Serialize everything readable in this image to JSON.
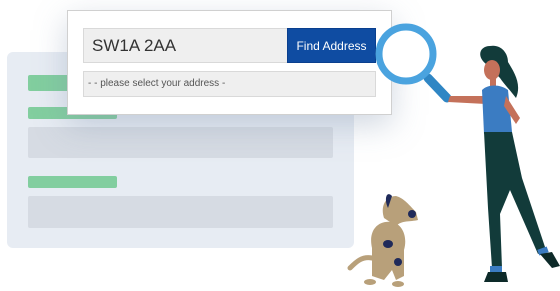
{
  "finder": {
    "postcode_value": "SW1A 2AA",
    "find_button_label": "Find Address",
    "select_placeholder": "- -   please select your address -"
  },
  "colors": {
    "accent": "#0f4ca2",
    "placeholder_bar": "#82ce9f",
    "placeholder_field": "#d6dbe3",
    "magnifier": "#4aa3df"
  },
  "icons": [
    "magnifying-glass-icon"
  ]
}
